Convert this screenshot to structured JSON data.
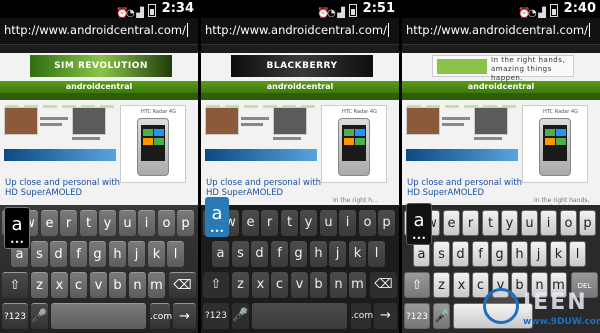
{
  "phones": [
    {
      "clock": "2:34",
      "url": "http://www.androidcentral.com/",
      "ad_text": "SIM REVOLUTION",
      "site_name": "androidcentral",
      "htc_caption": "HTC Radar 4G",
      "article_title": "Up close and personal with HD SuperAMOLED",
      "side_text": "",
      "popup_letter": "a"
    },
    {
      "clock": "2:51",
      "url": "http://www.androidcentral.com/",
      "ad_text": "BLACKBERRY",
      "site_name": "androidcentral",
      "htc_caption": "HTC Radar 4G",
      "article_title": "Up close and personal with HD SuperAMOLED",
      "side_text": "In the right h...",
      "popup_letter": "a"
    },
    {
      "clock": "2:40",
      "url": "http://www.androidcentral.com/",
      "ad_text": "In the right hands, amazing things happen.",
      "site_name": "androidcentral",
      "htc_caption": "HTC Radar 4G",
      "article_title": "Up close and personal with HD SuperAMOLED",
      "side_text": "In the right hands, amazing things happen.",
      "popup_letter": "a"
    }
  ],
  "keyboard_rows": {
    "row1": [
      "q",
      "w",
      "e",
      "r",
      "t",
      "y",
      "u",
      "i",
      "o",
      "p"
    ],
    "row2": [
      "a",
      "s",
      "d",
      "f",
      "g",
      "h",
      "j",
      "k",
      "l"
    ],
    "row3": [
      "z",
      "x",
      "c",
      "v",
      "b",
      "n",
      "m"
    ],
    "num_key": "?123",
    "del_label": "DEL"
  },
  "icons": {
    "shift": "shift-icon",
    "delete": "backspace-icon",
    "mic": "microphone-icon",
    "dotcom": ".com"
  },
  "watermark": {
    "letters": "ЈЕЕN",
    "url": "www.9DUW.com"
  },
  "colors": {
    "site_green": "#3d7a0c",
    "link_blue": "#1c4fa0",
    "ics_blue": "#2a7ab8"
  }
}
